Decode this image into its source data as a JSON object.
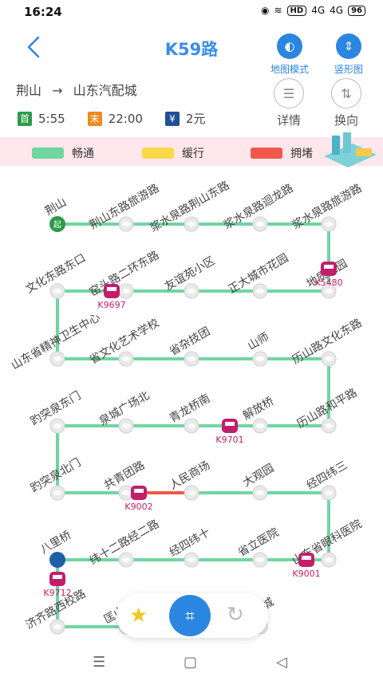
{
  "status_bar": {
    "time": "16:24",
    "battery": "96",
    "hd": "HD",
    "signal1": "4G",
    "signal2": "4G"
  },
  "header": {
    "title": "K59路",
    "map_mode_label": "地图模式",
    "vertical_label": "竖形图"
  },
  "route": {
    "from": "荆山",
    "arrow": "→",
    "to": "山东汽配城",
    "detail_label": "详情",
    "reverse_label": "换向",
    "first_tag": "首",
    "first_time": "5:55",
    "last_tag": "末",
    "last_time": "22:00",
    "fare_tag": "¥",
    "fare": "2元"
  },
  "legend": {
    "smooth": "畅通",
    "slow": "缓行",
    "jam": "拥堵",
    "colors": {
      "smooth": "#6fd6a0",
      "slow": "#f9d84a",
      "jam": "#f0584a"
    }
  },
  "start_marker": "起",
  "stops": [
    "荆山",
    "荆山东路旅游路",
    "浆水泉路荆山东路",
    "浆水泉路迴龙路",
    "浆水泉路旅游路",
    "地质家园",
    "正大城市花园",
    "友谊苑小区",
    "窑头路二环东路",
    "文化东路东口",
    "山东省精神卫生中心",
    "省文化艺术学校",
    "省杂技团",
    "山师",
    "历山路文化东路",
    "历山路和平路",
    "解放桥",
    "青龙桥南",
    "泉城广场北",
    "趵突泉东门",
    "趵突泉北门",
    "共青团路",
    "人民商场",
    "大观园",
    "经四纬三",
    "山东省眼科医院",
    "省立医院",
    "经四纬十",
    "纬十二路经二路",
    "八里桥",
    "济齐路西校路",
    "匡山小区",
    "西",
    "汽配城"
  ],
  "buses": [
    "K5480",
    "K9697",
    "K9701",
    "K9002",
    "K9001",
    "K9712"
  ],
  "bottom_bar": {
    "favorite": "★",
    "scan": "⌗",
    "refresh": "↻"
  },
  "nav": {
    "menu": "☰",
    "home": "▢",
    "back": "◁"
  }
}
